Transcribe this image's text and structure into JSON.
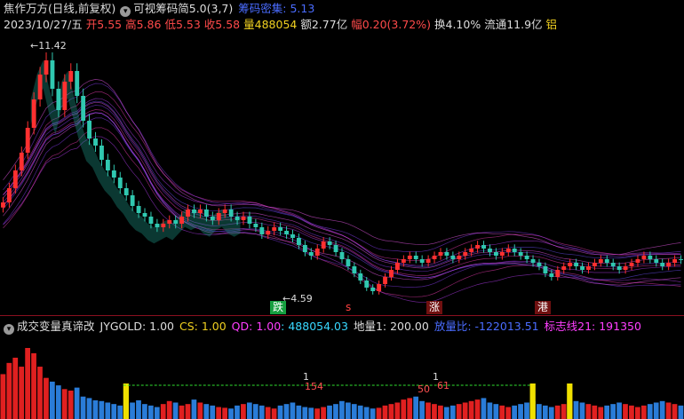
{
  "header": {
    "stock_name": "焦作万方",
    "period": "(日线,前复权)",
    "indicator_name": "可视筹码简5.0(3,7)",
    "indicator_extra": "筹码密集: 5.13",
    "date": "2023/10/27/五",
    "open_label": "开",
    "open": "5.55",
    "high_label": "高",
    "high": "5.86",
    "low_label": "低",
    "low": "5.53",
    "close_label": "收",
    "close": "5.58",
    "volume_label": "量",
    "volume": "488054",
    "amount_label": "额",
    "amount": "2.77亿",
    "change_label": "幅",
    "change": "0.20(3.72%)",
    "turnover_label": "换",
    "turnover": "4.10%",
    "float_label": "流通",
    "float": "11.9亿",
    "sector": "铝"
  },
  "lower": {
    "indicator_name": "成交变量真谛改",
    "jygold": "JYGOLD: 1.00",
    "cs": "CS: 1.00",
    "qd": "QD: 1.00",
    "qd_value": ": 488054.03",
    "dl": "地量1: 200.00",
    "bl": "放量比: -122013.51",
    "bz": "标志线21: 191350"
  },
  "annotations": {
    "high_price": "11.42",
    "low_price": "4.59",
    "tag_die": "跌",
    "tag_s": "s",
    "tag_zhang": "涨",
    "tag_gang": "港",
    "vol_one_a": "1",
    "vol_one_b": "1",
    "vol_154": "154",
    "vol_50": "50",
    "vol_61": "61"
  },
  "colors": {
    "up": "#ff3030",
    "down": "#30c8b0",
    "volup": "#e02020",
    "voldown": "#2a7cd8",
    "mark": "#f0e000"
  },
  "chart_data": {
    "type": "candlestick",
    "price_range": [
      4.2,
      11.8
    ],
    "closes": [
      7.2,
      7.6,
      8.1,
      8.6,
      9.3,
      10.1,
      10.8,
      11.2,
      10.4,
      9.8,
      10.6,
      10.9,
      10.2,
      9.5,
      9.0,
      8.8,
      8.4,
      8.1,
      7.9,
      7.6,
      7.4,
      7.1,
      6.9,
      6.8,
      6.6,
      6.5,
      6.6,
      6.7,
      6.6,
      6.8,
      7.0,
      6.9,
      7.0,
      6.8,
      6.7,
      6.9,
      7.0,
      6.8,
      6.7,
      6.8,
      6.6,
      6.5,
      6.3,
      6.4,
      6.5,
      6.4,
      6.3,
      6.2,
      6.0,
      5.8,
      5.7,
      5.9,
      6.1,
      6.0,
      5.8,
      5.6,
      5.4,
      5.2,
      5.0,
      4.8,
      4.7,
      4.9,
      5.1,
      5.3,
      5.5,
      5.6,
      5.7,
      5.6,
      5.5,
      5.6,
      5.7,
      5.8,
      5.7,
      5.6,
      5.7,
      5.8,
      5.9,
      6.0,
      5.9,
      5.8,
      5.7,
      5.8,
      5.9,
      5.8,
      5.7,
      5.6,
      5.5,
      5.4,
      5.2,
      5.1,
      5.3,
      5.4,
      5.5,
      5.4,
      5.3,
      5.4,
      5.5,
      5.6,
      5.5,
      5.4,
      5.3,
      5.4,
      5.5,
      5.6,
      5.7,
      5.6,
      5.5,
      5.4,
      5.5,
      5.6,
      5.58
    ],
    "volumes": [
      60,
      75,
      82,
      70,
      95,
      88,
      70,
      55,
      50,
      45,
      40,
      38,
      42,
      30,
      28,
      25,
      24,
      22,
      20,
      18,
      20,
      22,
      25,
      20,
      18,
      16,
      20,
      24,
      22,
      18,
      20,
      26,
      22,
      20,
      18,
      16,
      15,
      14,
      18,
      20,
      22,
      20,
      18,
      16,
      14,
      18,
      20,
      22,
      18,
      16,
      15,
      14,
      16,
      18,
      20,
      24,
      22,
      20,
      18,
      16,
      14,
      15,
      18,
      20,
      22,
      26,
      28,
      30,
      24,
      22,
      20,
      18,
      16,
      18,
      20,
      22,
      24,
      26,
      28,
      22,
      20,
      18,
      16,
      18,
      20,
      22,
      24,
      20,
      18,
      16,
      18,
      20,
      22,
      24,
      22,
      20,
      18,
      16,
      18,
      20,
      22,
      20,
      18,
      16,
      18,
      20,
      22,
      24,
      22,
      20,
      18
    ],
    "vol_markers": [
      20,
      86,
      92
    ]
  }
}
